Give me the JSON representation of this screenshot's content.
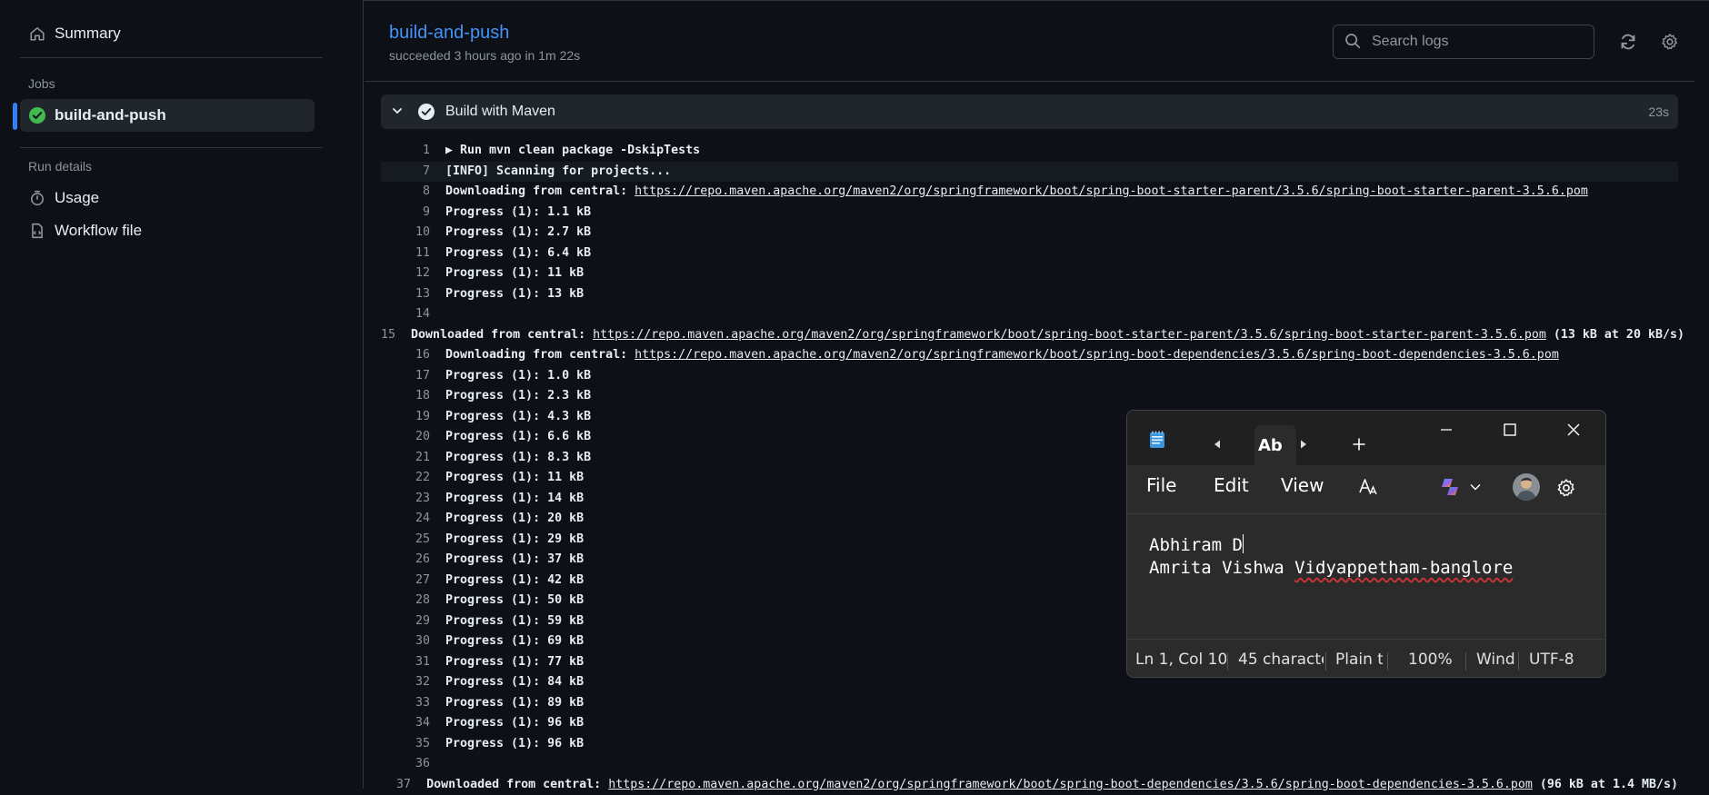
{
  "sidebar": {
    "summary_label": "Summary",
    "jobs_heading": "Jobs",
    "job_label": "build-and-push",
    "run_details_heading": "Run details",
    "usage_label": "Usage",
    "workflow_file_label": "Workflow file"
  },
  "header": {
    "title": "build-and-push",
    "subtitle": "succeeded 3 hours ago in 1m 22s",
    "search_placeholder": "Search logs"
  },
  "step": {
    "name": "Build with Maven",
    "duration": "23s"
  },
  "log_lines": [
    {
      "n": "1",
      "text": "▶ Run mvn clean package -DskipTests"
    },
    {
      "n": "7",
      "text": "[INFO] Scanning for projects...",
      "highlight": true
    },
    {
      "n": "8",
      "prefix": "Downloading from central: ",
      "link": "https://repo.maven.apache.org/maven2/org/springframework/boot/spring-boot-starter-parent/3.5.6/spring-boot-starter-parent-3.5.6.pom"
    },
    {
      "n": "9",
      "text": "Progress (1): 1.1 kB"
    },
    {
      "n": "10",
      "text": "Progress (1): 2.7 kB"
    },
    {
      "n": "11",
      "text": "Progress (1): 6.4 kB"
    },
    {
      "n": "12",
      "text": "Progress (1): 11 kB"
    },
    {
      "n": "13",
      "text": "Progress (1): 13 kB"
    },
    {
      "n": "14",
      "text": ""
    },
    {
      "n": "15",
      "prefix": "Downloaded from central: ",
      "link": "https://repo.maven.apache.org/maven2/org/springframework/boot/spring-boot-starter-parent/3.5.6/spring-boot-starter-parent-3.5.6.pom",
      "suffix": " (13 kB at 20 kB/s)"
    },
    {
      "n": "16",
      "prefix": "Downloading from central: ",
      "link": "https://repo.maven.apache.org/maven2/org/springframework/boot/spring-boot-dependencies/3.5.6/spring-boot-dependencies-3.5.6.pom"
    },
    {
      "n": "17",
      "text": "Progress (1): 1.0 kB"
    },
    {
      "n": "18",
      "text": "Progress (1): 2.3 kB"
    },
    {
      "n": "19",
      "text": "Progress (1): 4.3 kB"
    },
    {
      "n": "20",
      "text": "Progress (1): 6.6 kB"
    },
    {
      "n": "21",
      "text": "Progress (1): 8.3 kB"
    },
    {
      "n": "22",
      "text": "Progress (1): 11 kB"
    },
    {
      "n": "23",
      "text": "Progress (1): 14 kB"
    },
    {
      "n": "24",
      "text": "Progress (1): 20 kB"
    },
    {
      "n": "25",
      "text": "Progress (1): 29 kB"
    },
    {
      "n": "26",
      "text": "Progress (1): 37 kB"
    },
    {
      "n": "27",
      "text": "Progress (1): 42 kB"
    },
    {
      "n": "28",
      "text": "Progress (1): 50 kB"
    },
    {
      "n": "29",
      "text": "Progress (1): 59 kB"
    },
    {
      "n": "30",
      "text": "Progress (1): 69 kB"
    },
    {
      "n": "31",
      "text": "Progress (1): 77 kB"
    },
    {
      "n": "32",
      "text": "Progress (1): 84 kB"
    },
    {
      "n": "33",
      "text": "Progress (1): 89 kB"
    },
    {
      "n": "34",
      "text": "Progress (1): 96 kB"
    },
    {
      "n": "35",
      "text": "Progress (1): 96 kB"
    },
    {
      "n": "36",
      "text": ""
    },
    {
      "n": "37",
      "prefix": "Downloaded from central: ",
      "link": "https://repo.maven.apache.org/maven2/org/springframework/boot/spring-boot-dependencies/3.5.6/spring-boot-dependencies-3.5.6.pom",
      "suffix": " (96 kB at 1.4 MB/s)"
    }
  ],
  "notepad": {
    "tab_label": "Ab",
    "menu_file": "File",
    "menu_edit": "Edit",
    "menu_view": "View",
    "text_line1": "Abhiram D",
    "text_line2_a": "Amrita Vishwa ",
    "text_line2_b": "Vidyappetham-banglore",
    "status_position": "Ln 1, Col 10",
    "status_chars": "45 characte",
    "status_format": "Plain t",
    "status_zoom": "100%",
    "status_eol": "Wind",
    "status_encoding": "UTF-8"
  },
  "colors": {
    "accent": "#2f81f7",
    "success": "#3fb950",
    "link_title": "#4493f8"
  }
}
